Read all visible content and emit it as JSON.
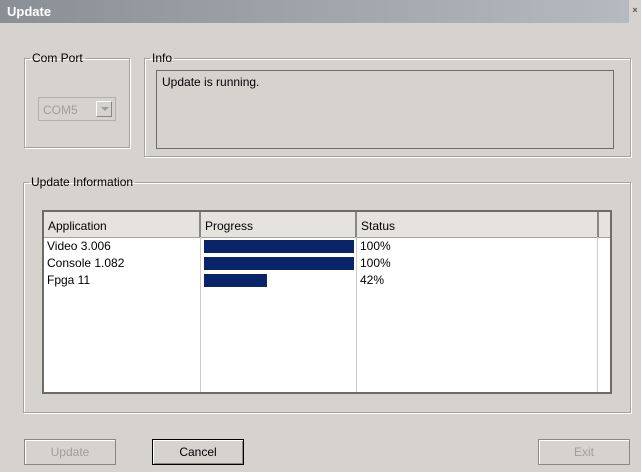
{
  "window": {
    "title": "Update",
    "close_glyph": "×"
  },
  "com_port": {
    "legend": "Com Port",
    "selected": "COM5"
  },
  "info": {
    "legend": "Info",
    "message": "Update is running."
  },
  "update_info": {
    "legend": "Update Information",
    "columns": [
      "Application",
      "Progress",
      "Status"
    ],
    "rows": [
      {
        "application": "Video  3.006",
        "progress": 1.0,
        "status": "100%"
      },
      {
        "application": "Console  1.082",
        "progress": 1.0,
        "status": "100%"
      },
      {
        "application": "Fpga 11",
        "progress": 0.42,
        "status": "42%"
      }
    ]
  },
  "buttons": {
    "update": "Update",
    "cancel": "Cancel",
    "exit": "Exit"
  },
  "colors": {
    "progress_fill": "#0a246a",
    "face": "#d6d3ce"
  }
}
